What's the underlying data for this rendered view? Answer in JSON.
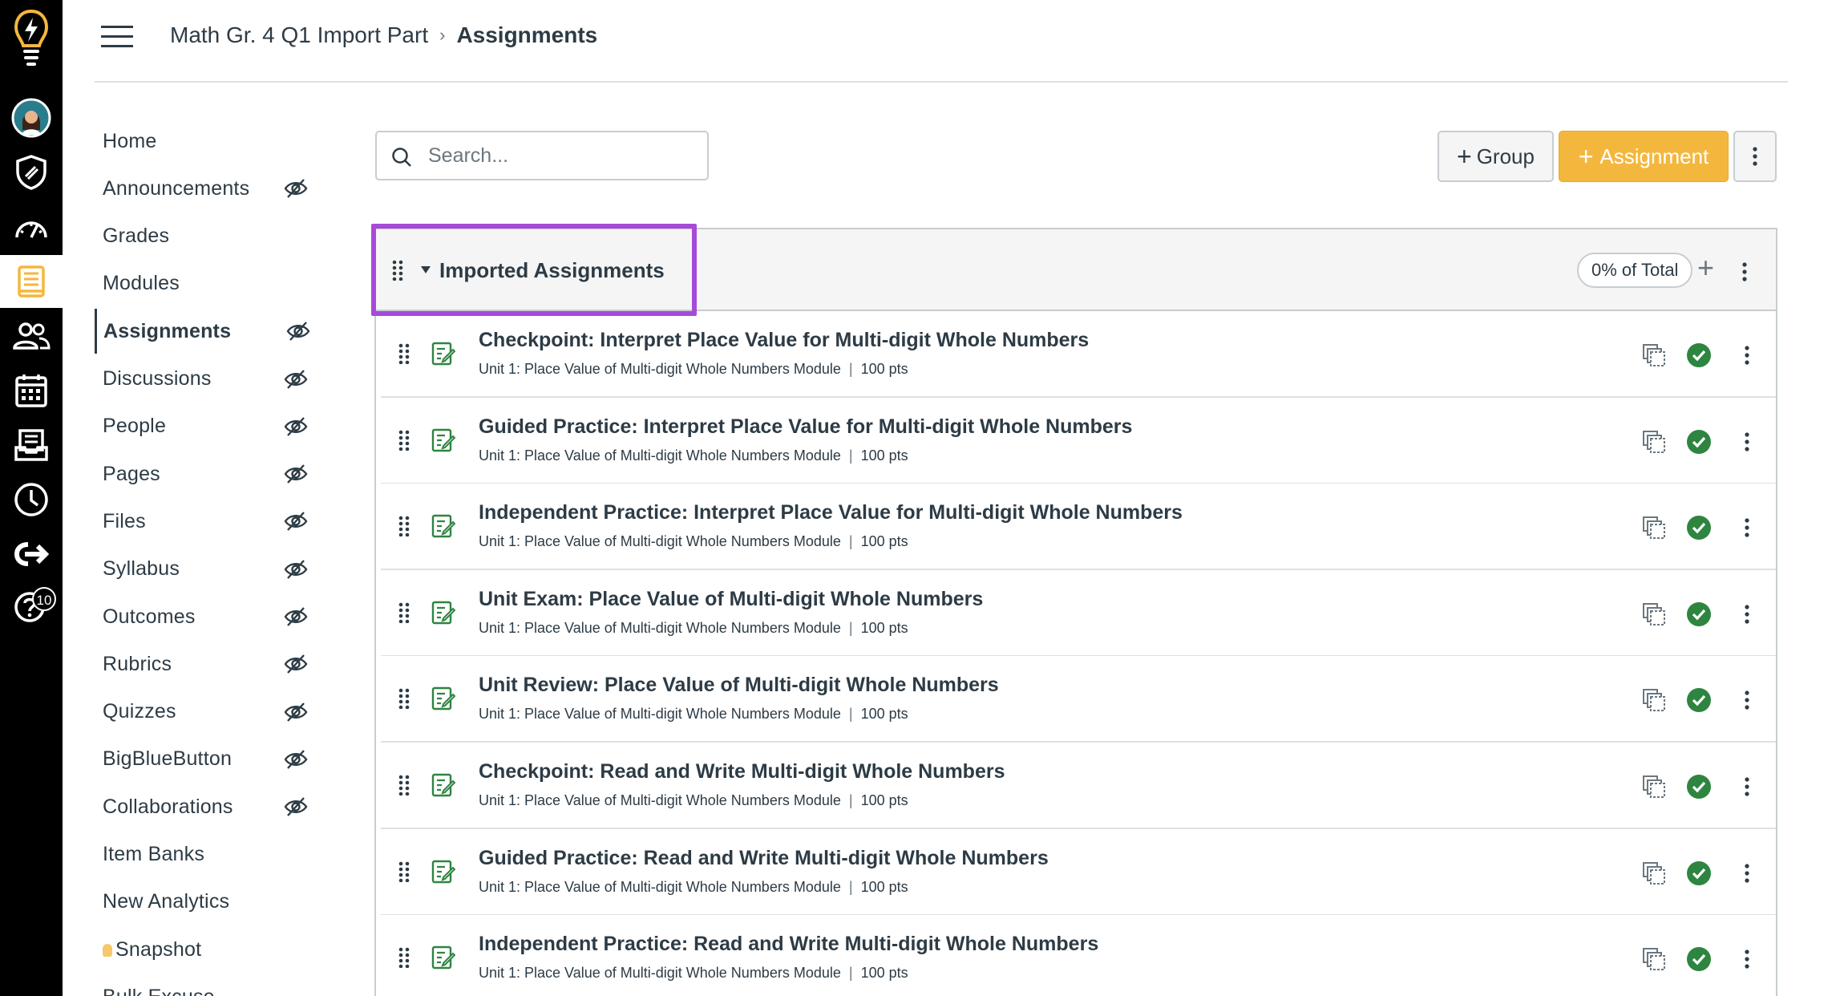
{
  "global_nav": {
    "icons": [
      "lightbulb-logo-icon",
      "user-avatar",
      "admin-shield-icon",
      "dashboard-icon",
      "courses-icon",
      "groups-icon",
      "calendar-icon",
      "inbox-icon",
      "history-icon",
      "commons-icon",
      "help-icon"
    ],
    "active": "courses-icon",
    "help_badge": "10"
  },
  "header": {
    "course": "Math Gr. 4 Q1 Import Part",
    "current": "Assignments"
  },
  "course_nav": [
    {
      "label": "Home",
      "hidden": false,
      "active": false
    },
    {
      "label": "Announcements",
      "hidden": true,
      "active": false
    },
    {
      "label": "Grades",
      "hidden": false,
      "active": false
    },
    {
      "label": "Modules",
      "hidden": false,
      "active": false
    },
    {
      "label": "Assignments",
      "hidden": true,
      "active": true
    },
    {
      "label": "Discussions",
      "hidden": true,
      "active": false
    },
    {
      "label": "People",
      "hidden": true,
      "active": false
    },
    {
      "label": "Pages",
      "hidden": true,
      "active": false
    },
    {
      "label": "Files",
      "hidden": true,
      "active": false
    },
    {
      "label": "Syllabus",
      "hidden": true,
      "active": false
    },
    {
      "label": "Outcomes",
      "hidden": true,
      "active": false
    },
    {
      "label": "Rubrics",
      "hidden": true,
      "active": false
    },
    {
      "label": "Quizzes",
      "hidden": true,
      "active": false
    },
    {
      "label": "BigBlueButton",
      "hidden": true,
      "active": false
    },
    {
      "label": "Collaborations",
      "hidden": true,
      "active": false
    },
    {
      "label": "Item Banks",
      "hidden": false,
      "active": false
    },
    {
      "label": "New Analytics",
      "hidden": false,
      "active": false
    },
    {
      "label": "Snapshot",
      "hidden": false,
      "active": false
    },
    {
      "label": "Bulk Excuse",
      "hidden": false,
      "active": false
    }
  ],
  "toolbar": {
    "search_placeholder": "Search...",
    "group_label": "Group",
    "assignment_label": "Assignment"
  },
  "group": {
    "title": "Imported Assignments",
    "weight": "0% of Total"
  },
  "assignments": [
    {
      "title": "Checkpoint: Interpret Place Value for Multi-digit Whole Numbers",
      "module": "Unit 1: Place Value of Multi-digit Whole Numbers Module",
      "points": "100 pts"
    },
    {
      "title": "Guided Practice: Interpret Place Value for Multi-digit Whole Numbers",
      "module": "Unit 1: Place Value of Multi-digit Whole Numbers Module",
      "points": "100 pts"
    },
    {
      "title": "Independent Practice: Interpret Place Value for Multi-digit Whole Numbers",
      "module": "Unit 1: Place Value of Multi-digit Whole Numbers Module",
      "points": "100 pts"
    },
    {
      "title": "Unit Exam: Place Value of Multi-digit Whole Numbers",
      "module": "Unit 1: Place Value of Multi-digit Whole Numbers Module",
      "points": "100 pts"
    },
    {
      "title": "Unit Review: Place Value of Multi-digit Whole Numbers",
      "module": "Unit 1: Place Value of Multi-digit Whole Numbers Module",
      "points": "100 pts"
    },
    {
      "title": "Checkpoint: Read and Write Multi-digit Whole Numbers",
      "module": "Unit 1: Place Value of Multi-digit Whole Numbers Module",
      "points": "100 pts"
    },
    {
      "title": "Guided Practice: Read and Write Multi-digit Whole Numbers",
      "module": "Unit 1: Place Value of Multi-digit Whole Numbers Module",
      "points": "100 pts"
    },
    {
      "title": "Independent Practice: Read and Write Multi-digit Whole Numbers",
      "module": "Unit 1: Place Value of Multi-digit Whole Numbers Module",
      "points": "100 pts"
    }
  ],
  "colors": {
    "global_nav_bg": "#000000",
    "accent_yellow": "#f4b73e",
    "published_green": "#2e8540",
    "highlight_purple": "#a64ad8"
  }
}
